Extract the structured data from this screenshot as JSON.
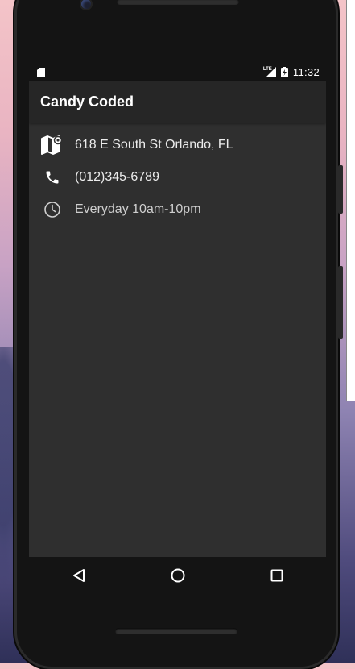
{
  "status_bar": {
    "time": "11:32",
    "network_label": "LTE"
  },
  "app_bar": {
    "title": "Candy Coded"
  },
  "info": [
    {
      "icon": "map-icon",
      "text": "618 E South St Orlando, FL"
    },
    {
      "icon": "phone-icon",
      "text": "(012)345-6789"
    },
    {
      "icon": "clock-icon",
      "text": "Everyday 10am-10pm"
    }
  ],
  "nav": {
    "back": "back-icon",
    "home": "home-icon",
    "recents": "recents-icon"
  },
  "colors": {
    "screen_bg": "#2f2f2f",
    "app_bar_bg": "#262626",
    "status_bar_bg": "#141414",
    "text": "#ececec"
  }
}
